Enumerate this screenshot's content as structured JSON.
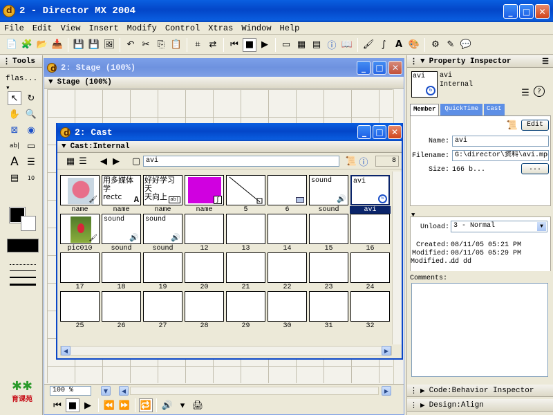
{
  "app": {
    "title": "2 - Director MX 2004"
  },
  "menu": [
    "File",
    "Edit",
    "View",
    "Insert",
    "Modify",
    "Control",
    "Xtras",
    "Window",
    "Help"
  ],
  "tools": {
    "title": "Tools",
    "dropdown": "flas..."
  },
  "stage": {
    "title": "2: Stage (100%)",
    "subtitle": "Stage (100%)",
    "zoom": "100 %"
  },
  "cast": {
    "title": "2: Cast",
    "subtitle": "Cast:Internal",
    "member_name": "avi",
    "member_number": "8",
    "cells": [
      {
        "label": "name",
        "thumb": "bird-image",
        "text": ""
      },
      {
        "label": "name",
        "thumb": "text",
        "text": "用多媒体学\nrectc"
      },
      {
        "label": "name",
        "thumb": "text",
        "text": "好好学习天\n天向上"
      },
      {
        "label": "name",
        "thumb": "magenta",
        "text": ""
      },
      {
        "label": "5",
        "thumb": "line",
        "text": ""
      },
      {
        "label": "6",
        "thumb": "blank-shape",
        "text": ""
      },
      {
        "label": "sound",
        "thumb": "sound",
        "text": "sound"
      },
      {
        "label": "avi",
        "thumb": "avi",
        "text": "avi"
      },
      {
        "label": "pic010",
        "thumb": "flower-image",
        "text": ""
      },
      {
        "label": "sound",
        "thumb": "sound",
        "text": "sound"
      },
      {
        "label": "sound",
        "thumb": "sound",
        "text": "sound"
      },
      {
        "label": "12"
      },
      {
        "label": "13"
      },
      {
        "label": "14"
      },
      {
        "label": "15"
      },
      {
        "label": "16"
      },
      {
        "label": "17"
      },
      {
        "label": "18"
      },
      {
        "label": "19"
      },
      {
        "label": "20"
      },
      {
        "label": "21"
      },
      {
        "label": "22"
      },
      {
        "label": "23"
      },
      {
        "label": "24"
      },
      {
        "label": "25"
      },
      {
        "label": "26"
      },
      {
        "label": "27"
      },
      {
        "label": "28"
      },
      {
        "label": "29"
      },
      {
        "label": "30"
      },
      {
        "label": "31"
      },
      {
        "label": "32"
      }
    ]
  },
  "inspector": {
    "title": "Property Inspector",
    "member_name": "avi",
    "member_type": "Internal",
    "tabs": [
      "Member",
      "QuickTime",
      "Cast"
    ],
    "edit_label": "Edit",
    "name_label": "Name:",
    "name_value": "avi",
    "filename_label": "Filename:",
    "filename_value": "G:\\director\\资料\\avi.mpg",
    "size_label": "Size:",
    "size_value": "166 b...",
    "browse_label": "...",
    "unload_label": "Unload:",
    "unload_value": "3 - Normal",
    "created_label": "Created:",
    "created_value": "08/11/05 05:21 PM",
    "modified_label": "Modified:",
    "modified_value": "08/11/05 05:29 PM",
    "modifiedby_label": "Modified...",
    "modifiedby_value": "dd dd",
    "comments_label": "Comments:",
    "panel_code": "Code:Behavior Inspector",
    "panel_design": "Design:Align"
  },
  "logo": {
    "text": "育课苑"
  }
}
